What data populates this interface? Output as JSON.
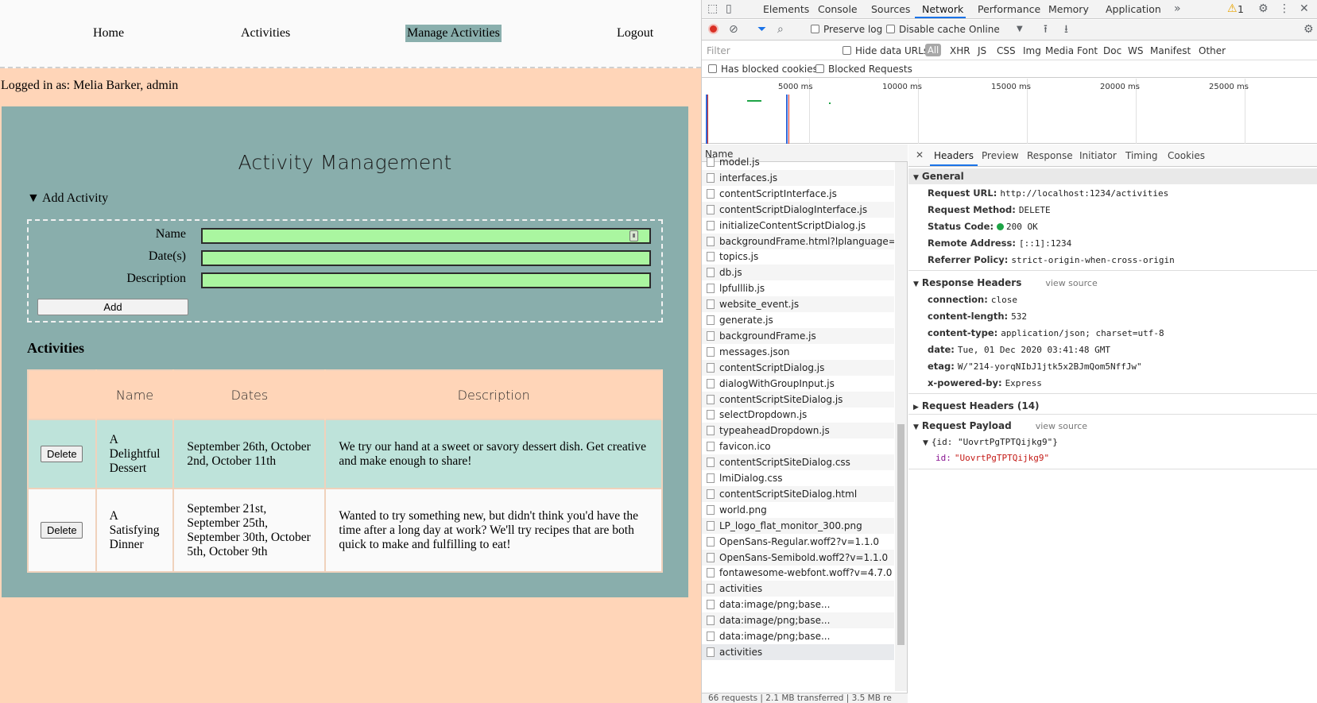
{
  "nav": {
    "home": "Home",
    "activities": "Activities",
    "manage": "Manage Activities",
    "logout": "Logout"
  },
  "logged_in": "Logged in as: Melia Barker, admin",
  "panel": {
    "title": "Activity Management",
    "summary": "▼ Add Activity",
    "form": {
      "name_label": "Name",
      "dates_label": "Date(s)",
      "desc_label": "Description",
      "add_button": "Add"
    },
    "activities_heading": "Activities",
    "table": {
      "headers": [
        "",
        "Name",
        "Dates",
        "Description"
      ],
      "delete_label": "Delete",
      "rows": [
        {
          "name": "A Delightful Dessert",
          "dates": "September 26th, October 2nd, October 11th",
          "description": "We try our hand at a sweet or savory dessert dish. Get creative and make enough to share!"
        },
        {
          "name": "A Satisfying Dinner",
          "dates": "September 21st, September 25th, September 30th, October 5th, October 9th",
          "description": "Wanted to try something new, but didn't think you'd have the time after a long day at work? We'll try recipes that are both quick to make and fulfilling to eat!"
        }
      ]
    }
  },
  "devtools": {
    "tabs": [
      "Elements",
      "Console",
      "Sources",
      "Network",
      "Performance",
      "Memory",
      "Application"
    ],
    "active_tab": "Network",
    "warning_count": "1",
    "toolbar": {
      "preserve_log": "Preserve log",
      "disable_cache": "Disable cache",
      "throttle": "Online"
    },
    "filter": {
      "placeholder": "Filter",
      "hide_data_urls": "Hide data URLs",
      "types": [
        "All",
        "XHR",
        "JS",
        "CSS",
        "Img",
        "Media",
        "Font",
        "Doc",
        "WS",
        "Manifest",
        "Other"
      ],
      "has_blocked_cookies": "Has blocked cookies",
      "blocked_requests": "Blocked Requests"
    },
    "timeline_ticks": [
      "5000 ms",
      "10000 ms",
      "15000 ms",
      "20000 ms",
      "25000 ms"
    ],
    "name_header": "Name",
    "requests": [
      "model.js",
      "interfaces.js",
      "contentScriptInterface.js",
      "contentScriptDialogInterface.js",
      "initializeContentScriptDialog.js",
      "backgroundFrame.html?lplanguage=en_U",
      "topics.js",
      "db.js",
      "lpfulllib.js",
      "website_event.js",
      "generate.js",
      "backgroundFrame.js",
      "messages.json",
      "contentScriptDialog.js",
      "dialogWithGroupInput.js",
      "contentScriptSiteDialog.js",
      "selectDropdown.js",
      "typeaheadDropdown.js",
      "favicon.ico",
      "contentScriptSiteDialog.css",
      "lmiDialog.css",
      "contentScriptSiteDialog.html",
      "world.png",
      "LP_logo_flat_monitor_300.png",
      "OpenSans-Regular.woff2?v=1.1.0",
      "OpenSans-Semibold.woff2?v=1.1.0",
      "fontawesome-webfont.woff?v=4.7.0",
      "activities",
      "data:image/png;base...",
      "data:image/png;base...",
      "data:image/png;base...",
      "activities"
    ],
    "detail_tabs": [
      "Headers",
      "Preview",
      "Response",
      "Initiator",
      "Timing",
      "Cookies"
    ],
    "general": {
      "title": "General",
      "request_url_k": "Request URL:",
      "request_url": "http://localhost:1234/activities",
      "method_k": "Request Method:",
      "method": "DELETE",
      "status_k": "Status Code:",
      "status": "200 OK",
      "remote_k": "Remote Address:",
      "remote": "[::1]:1234",
      "referrer_k": "Referrer Policy:",
      "referrer": "strict-origin-when-cross-origin"
    },
    "response_headers": {
      "title": "Response Headers",
      "view_source": "view source",
      "items": [
        {
          "k": "connection:",
          "v": "close"
        },
        {
          "k": "content-length:",
          "v": "532"
        },
        {
          "k": "content-type:",
          "v": "application/json; charset=utf-8"
        },
        {
          "k": "date:",
          "v": "Tue, 01 Dec 2020 03:41:48 GMT"
        },
        {
          "k": "etag:",
          "v": "W/\"214-yorqNIbJ1jtk5x2BJmQom5NffJw\""
        },
        {
          "k": "x-powered-by:",
          "v": "Express"
        }
      ]
    },
    "request_headers": "Request Headers (14)",
    "payload": {
      "title": "Request Payload",
      "view_source": "view source",
      "object": "{id: \"UovrtPgTPTQijkg9\"}",
      "id_key": "id:",
      "id_value": "\"UovrtPgTPTQijkg9\""
    },
    "status_bar": "66 requests | 2.1 MB transferred | 3.5 MB re"
  }
}
